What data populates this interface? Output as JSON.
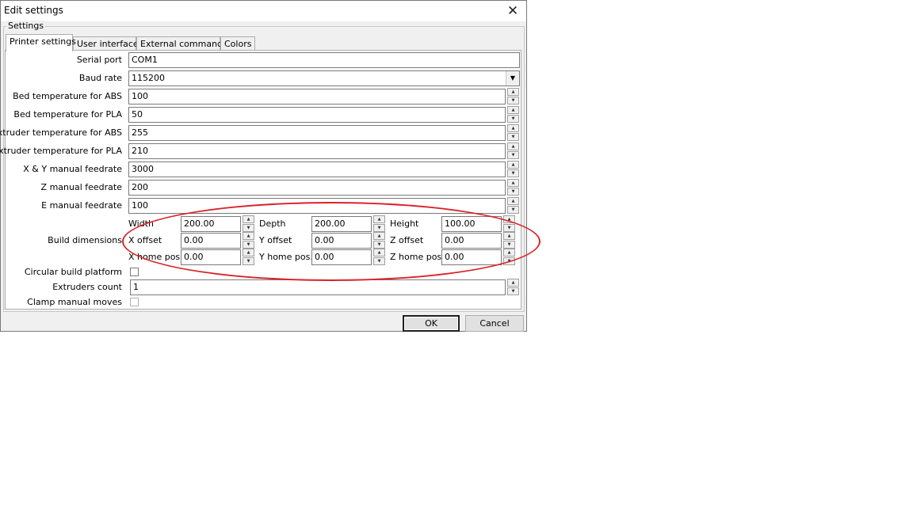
{
  "window": {
    "title": "Edit settings",
    "close_glyph": "✕"
  },
  "group_label": "Settings",
  "tabs": [
    {
      "label": "Printer settings",
      "active": true
    },
    {
      "label": "User interface"
    },
    {
      "label": "External commands"
    },
    {
      "label": "Colors"
    }
  ],
  "fields": {
    "serial_port": {
      "label": "Serial port",
      "value": "COM1"
    },
    "baud_rate": {
      "label": "Baud rate",
      "value": "115200"
    },
    "bed_abs": {
      "label": "Bed temperature for ABS",
      "value": "100"
    },
    "bed_pla": {
      "label": "Bed temperature for PLA",
      "value": "50"
    },
    "ext_abs": {
      "label": "Extruder temperature for ABS",
      "value": "255"
    },
    "ext_pla": {
      "label": "Extruder temperature for PLA",
      "value": "210"
    },
    "xy_feed": {
      "label": "X & Y manual feedrate",
      "value": "3000"
    },
    "z_feed": {
      "label": "Z manual feedrate",
      "value": "200"
    },
    "e_feed": {
      "label": "E manual feedrate",
      "value": "100"
    }
  },
  "build": {
    "label": "Build dimensions",
    "width": {
      "label": "Width",
      "value": "200.00"
    },
    "depth": {
      "label": "Depth",
      "value": "200.00"
    },
    "height": {
      "label": "Height",
      "value": "100.00"
    },
    "x_offset": {
      "label": "X offset",
      "value": "0.00"
    },
    "y_offset": {
      "label": "Y offset",
      "value": "0.00"
    },
    "z_offset": {
      "label": "Z offset",
      "value": "0.00"
    },
    "x_home": {
      "label": "X home pos.",
      "value": "0.00"
    },
    "y_home": {
      "label": "Y home pos.",
      "value": "0.00"
    },
    "z_home": {
      "label": "Z home pos.",
      "value": "0.00"
    }
  },
  "circular": {
    "label": "Circular build platform",
    "checked": false
  },
  "extruders": {
    "label": "Extruders count",
    "value": "1"
  },
  "clamp": {
    "label": "Clamp manual moves",
    "checked": false
  },
  "buttons": {
    "ok": "OK",
    "cancel": "Cancel"
  },
  "annotation": {
    "color": "#d9222a"
  },
  "icons": {
    "spin_up": "▲",
    "spin_down": "▼",
    "dropdown": "▼"
  }
}
